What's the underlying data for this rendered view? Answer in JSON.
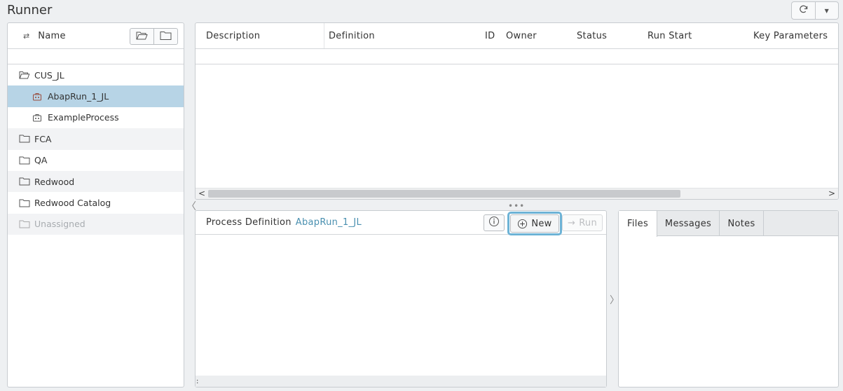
{
  "app": {
    "title": "Runner"
  },
  "tree": {
    "header_label": "Name",
    "items": [
      {
        "label": "CUS_JL",
        "type": "folder-open",
        "level": 0,
        "state": "normal"
      },
      {
        "label": "AbapRun_1_JL",
        "type": "process",
        "level": 1,
        "state": "selected"
      },
      {
        "label": "ExampleProcess",
        "type": "process",
        "level": 1,
        "state": "normal"
      },
      {
        "label": "FCA",
        "type": "folder",
        "level": 0,
        "state": "normal"
      },
      {
        "label": "QA",
        "type": "folder",
        "level": 0,
        "state": "normal"
      },
      {
        "label": "Redwood",
        "type": "folder",
        "level": 0,
        "state": "normal"
      },
      {
        "label": "Redwood Catalog",
        "type": "folder",
        "level": 0,
        "state": "normal"
      },
      {
        "label": "Unassigned",
        "type": "folder",
        "level": 0,
        "state": "disabled"
      }
    ]
  },
  "grid": {
    "columns": {
      "description": "Description",
      "definition": "Definition",
      "id": "ID",
      "owner": "Owner",
      "status": "Status",
      "run_start": "Run Start",
      "key_parameters": "Key Parameters"
    }
  },
  "definition_panel": {
    "label": "Process Definition",
    "name": "AbapRun_1_JL",
    "new_label": "New",
    "run_label": "Run",
    "footer_mark": ":"
  },
  "tabs": {
    "files": "Files",
    "messages": "Messages",
    "notes": "Notes"
  },
  "colors": {
    "accent": "#4a90b0",
    "selection": "#b7d4e6",
    "highlight_outline": "#6db3d6"
  }
}
